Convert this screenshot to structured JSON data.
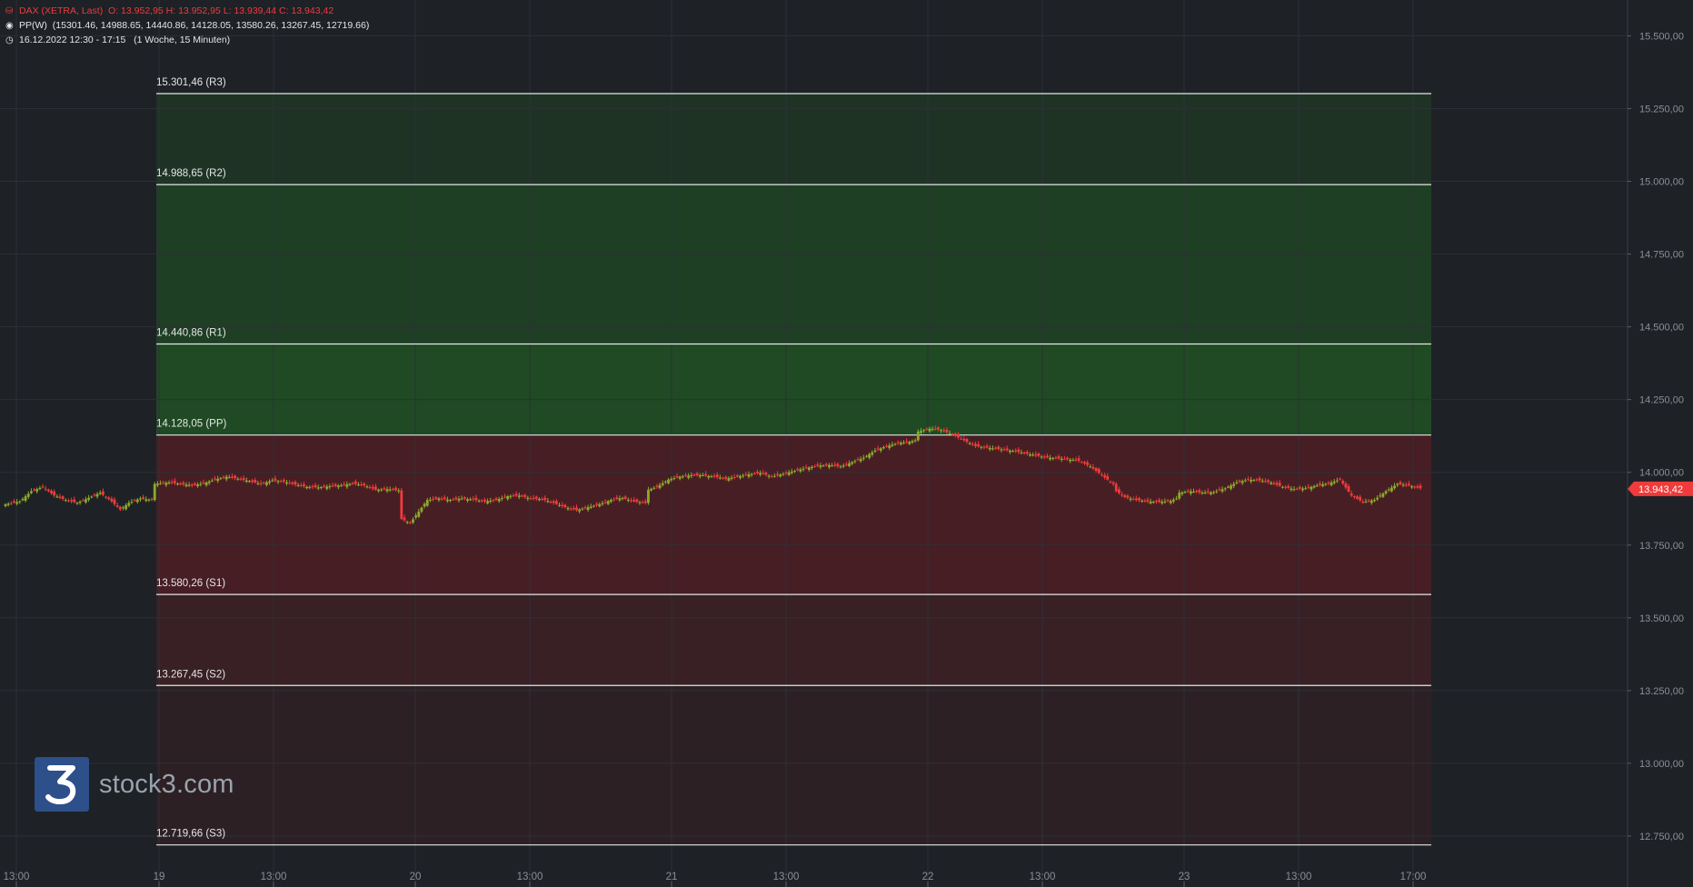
{
  "header": {
    "instrument": "DAX (XETRA, Last)",
    "ohlc": "O: 13.952,95  H: 13.952,95  L: 13.939,44  C: 13.943,42",
    "indicator_name": "PP(W)",
    "indicator_values": "(15301.46, 14988.65, 14440.86, 14128.05, 13580.26, 13267.45, 12719.66)",
    "range": "16.12.2022 12:30 - 17:15",
    "interval": "(1 Woche, 15 Minuten)"
  },
  "logo": {
    "text": "stock3.com"
  },
  "colors": {
    "background": "#1e2126",
    "up": "#8cab2a",
    "down": "#ef3b3b",
    "resistance_zone": "#1f4a24",
    "support_zone": "#4a1f24",
    "level_line": "#e6e6e6",
    "price_tag": "#ef3b3b"
  },
  "chart_data": {
    "type": "candlestick",
    "y_axis_position": "right",
    "ylim": [
      12650,
      15570
    ],
    "y_ticks": [
      12750,
      13000,
      13250,
      13500,
      13750,
      14000,
      14250,
      14500,
      14750,
      15000,
      15250,
      15500
    ],
    "y_tick_labels": [
      "12.750,00",
      "13.000,00",
      "13.250,00",
      "13.500,00",
      "13.750,00",
      "14.000,00",
      "14.250,00",
      "14.500,00",
      "14.750,00",
      "15.000,00",
      "15.250,00",
      "15.500,00"
    ],
    "x_tick_labels": [
      "13:00",
      "19",
      "13:00",
      "20",
      "13:00",
      "21",
      "13:00",
      "22",
      "13:00",
      "23",
      "13:00",
      "17:00"
    ],
    "last_price_label": "13.943,42",
    "last_price": 13943.42,
    "pivot_levels": [
      {
        "name": "R3",
        "value": 15301.46,
        "label": "15.301,46 (R3)"
      },
      {
        "name": "R2",
        "value": 14988.65,
        "label": "14.988,65 (R2)"
      },
      {
        "name": "R1",
        "value": 14440.86,
        "label": "14.440,86 (R1)"
      },
      {
        "name": "PP",
        "value": 14128.05,
        "label": "14.128,05 (PP)"
      },
      {
        "name": "S1",
        "value": 13580.26,
        "label": "13.580,26 (S1)"
      },
      {
        "name": "S2",
        "value": 13267.45,
        "label": "13.267,45 (S2)"
      },
      {
        "name": "S3",
        "value": 12719.66,
        "label": "12.719,66 (S3)"
      }
    ],
    "price_path": [
      [
        0,
        13890
      ],
      [
        5,
        13900
      ],
      [
        9,
        13935
      ],
      [
        13,
        13950
      ],
      [
        17,
        13920
      ],
      [
        21,
        13905
      ],
      [
        25,
        13895
      ],
      [
        29,
        13912
      ],
      [
        33,
        13930
      ],
      [
        37,
        13900
      ],
      [
        40,
        13872
      ],
      [
        43,
        13895
      ],
      [
        47,
        13910
      ],
      [
        51,
        13905
      ],
      [
        52,
        13960
      ],
      [
        57,
        13965
      ],
      [
        61,
        13960
      ],
      [
        65,
        13955
      ],
      [
        69,
        13962
      ],
      [
        73,
        13975
      ],
      [
        77,
        13985
      ],
      [
        81,
        13978
      ],
      [
        85,
        13970
      ],
      [
        89,
        13960
      ],
      [
        93,
        13972
      ],
      [
        97,
        13968
      ],
      [
        101,
        13958
      ],
      [
        105,
        13950
      ],
      [
        109,
        13948
      ],
      [
        113,
        13952
      ],
      [
        117,
        13955
      ],
      [
        121,
        13962
      ],
      [
        125,
        13955
      ],
      [
        129,
        13940
      ],
      [
        133,
        13942
      ],
      [
        137,
        13938
      ],
      [
        138,
        13840
      ],
      [
        141,
        13825
      ],
      [
        144,
        13865
      ],
      [
        147,
        13905
      ],
      [
        151,
        13910
      ],
      [
        155,
        13905
      ],
      [
        159,
        13910
      ],
      [
        163,
        13906
      ],
      [
        167,
        13900
      ],
      [
        171,
        13905
      ],
      [
        175,
        13918
      ],
      [
        179,
        13920
      ],
      [
        183,
        13910
      ],
      [
        187,
        13908
      ],
      [
        191,
        13895
      ],
      [
        195,
        13880
      ],
      [
        199,
        13870
      ],
      [
        203,
        13880
      ],
      [
        207,
        13890
      ],
      [
        211,
        13905
      ],
      [
        215,
        13912
      ],
      [
        219,
        13900
      ],
      [
        223,
        13895
      ],
      [
        224,
        13940
      ],
      [
        227,
        13950
      ],
      [
        231,
        13975
      ],
      [
        235,
        13985
      ],
      [
        239,
        13990
      ],
      [
        243,
        13990
      ],
      [
        247,
        13985
      ],
      [
        251,
        13978
      ],
      [
        255,
        13985
      ],
      [
        259,
        13993
      ],
      [
        263,
        13998
      ],
      [
        267,
        13985
      ],
      [
        271,
        13995
      ],
      [
        275,
        14005
      ],
      [
        279,
        14015
      ],
      [
        283,
        14022
      ],
      [
        287,
        14025
      ],
      [
        291,
        14020
      ],
      [
        295,
        14035
      ],
      [
        299,
        14050
      ],
      [
        303,
        14075
      ],
      [
        307,
        14090
      ],
      [
        311,
        14100
      ],
      [
        315,
        14105
      ],
      [
        317,
        14110
      ],
      [
        318,
        14140
      ],
      [
        322,
        14150
      ],
      [
        326,
        14145
      ],
      [
        330,
        14130
      ],
      [
        334,
        14110
      ],
      [
        338,
        14090
      ],
      [
        342,
        14085
      ],
      [
        346,
        14080
      ],
      [
        350,
        14075
      ],
      [
        354,
        14068
      ],
      [
        358,
        14060
      ],
      [
        362,
        14052
      ],
      [
        366,
        14048
      ],
      [
        370,
        14045
      ],
      [
        374,
        14040
      ],
      [
        378,
        14020
      ],
      [
        382,
        13990
      ],
      [
        386,
        13960
      ],
      [
        387,
        13935
      ],
      [
        390,
        13915
      ],
      [
        394,
        13905
      ],
      [
        398,
        13900
      ],
      [
        402,
        13898
      ],
      [
        406,
        13902
      ],
      [
        408,
        13910
      ],
      [
        409,
        13930
      ],
      [
        413,
        13935
      ],
      [
        417,
        13930
      ],
      [
        421,
        13932
      ],
      [
        425,
        13945
      ],
      [
        429,
        13965
      ],
      [
        433,
        13975
      ],
      [
        437,
        13972
      ],
      [
        441,
        13965
      ],
      [
        445,
        13950
      ],
      [
        449,
        13942
      ],
      [
        453,
        13945
      ],
      [
        457,
        13955
      ],
      [
        461,
        13962
      ],
      [
        465,
        13975
      ],
      [
        469,
        13920
      ],
      [
        473,
        13898
      ],
      [
        477,
        13905
      ],
      [
        481,
        13935
      ],
      [
        485,
        13960
      ],
      [
        489,
        13955
      ],
      [
        493,
        13945
      ]
    ]
  }
}
